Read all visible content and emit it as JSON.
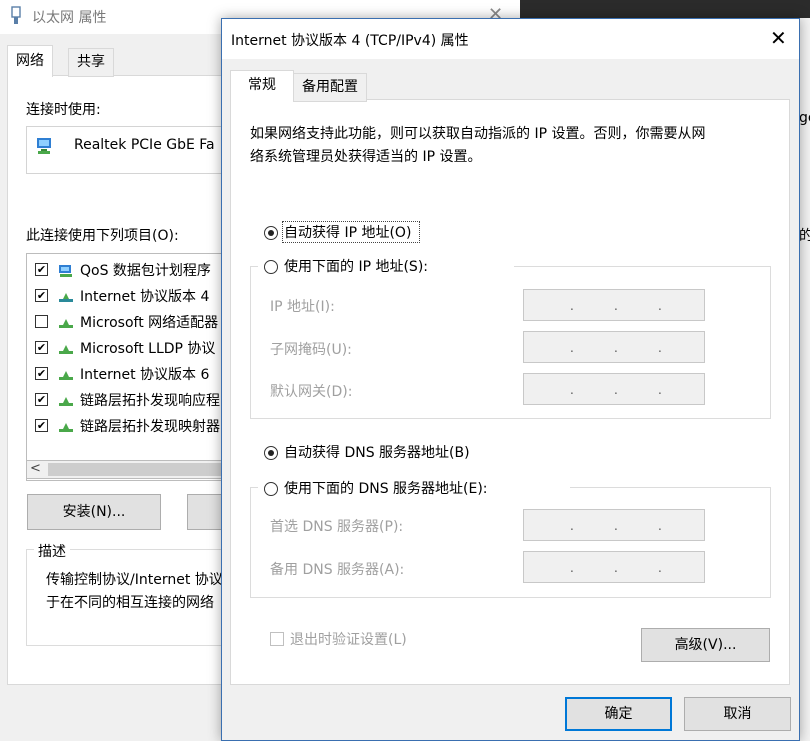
{
  "bg_window": {
    "title": "以太网 属性",
    "tabs": [
      "网络",
      "共享"
    ],
    "connect_using_label": "连接时使用:",
    "adapter_name": "Realtek PCIe GbE Fa",
    "items_label": "此连接使用下列项目(O):",
    "items": [
      {
        "label": "QoS 数据包计划程序",
        "checked": true,
        "icon": "qos-network-icon"
      },
      {
        "label": "Internet 协议版本 4",
        "checked": true,
        "icon": "protocol-icon"
      },
      {
        "label": "Microsoft 网络适配器",
        "checked": false,
        "icon": "protocol-icon"
      },
      {
        "label": "Microsoft LLDP 协议",
        "checked": true,
        "icon": "protocol-icon"
      },
      {
        "label": "Internet 协议版本 6",
        "checked": true,
        "icon": "protocol-icon"
      },
      {
        "label": "链路层拓扑发现响应程",
        "checked": true,
        "icon": "protocol-icon"
      },
      {
        "label": "链路层拓扑发现映射器",
        "checked": true,
        "icon": "protocol-icon"
      }
    ],
    "scroll_left_glyph": "<",
    "install_label": "安装(N)...",
    "description_label": "描述",
    "description_line1": "传输控制协议/Internet 协议",
    "description_line2": "于在不同的相互连接的网络"
  },
  "right_edge": {
    "text_g": "ge",
    "text_de": "的"
  },
  "dialog": {
    "title": "Internet 协议版本 4 (TCP/IPv4) 属性",
    "close_glyph": "✕",
    "tabs": {
      "general": "常规",
      "alternate": "备用配置"
    },
    "info_line1": "如果网络支持此功能，则可以获取自动指派的 IP 设置。否则，你需要从网",
    "info_line2": "络系统管理员处获得适当的 IP 设置。",
    "ip_auto": "自动获得 IP 地址(O)",
    "ip_manual": "使用下面的 IP 地址(S):",
    "ip_address_label": "IP 地址(I):",
    "subnet_label": "子网掩码(U):",
    "gateway_label": "默认网关(D):",
    "dns_auto": "自动获得 DNS 服务器地址(B)",
    "dns_manual": "使用下面的 DNS 服务器地址(E):",
    "dns_preferred_label": "首选 DNS 服务器(P):",
    "dns_alternate_label": "备用 DNS 服务器(A):",
    "ip_dot": ".",
    "validate_on_exit": "退出时验证设置(L)",
    "advanced": "高级(V)...",
    "ok": "确定",
    "cancel": "取消",
    "selected_ip_mode": "auto",
    "selected_dns_mode": "auto"
  }
}
